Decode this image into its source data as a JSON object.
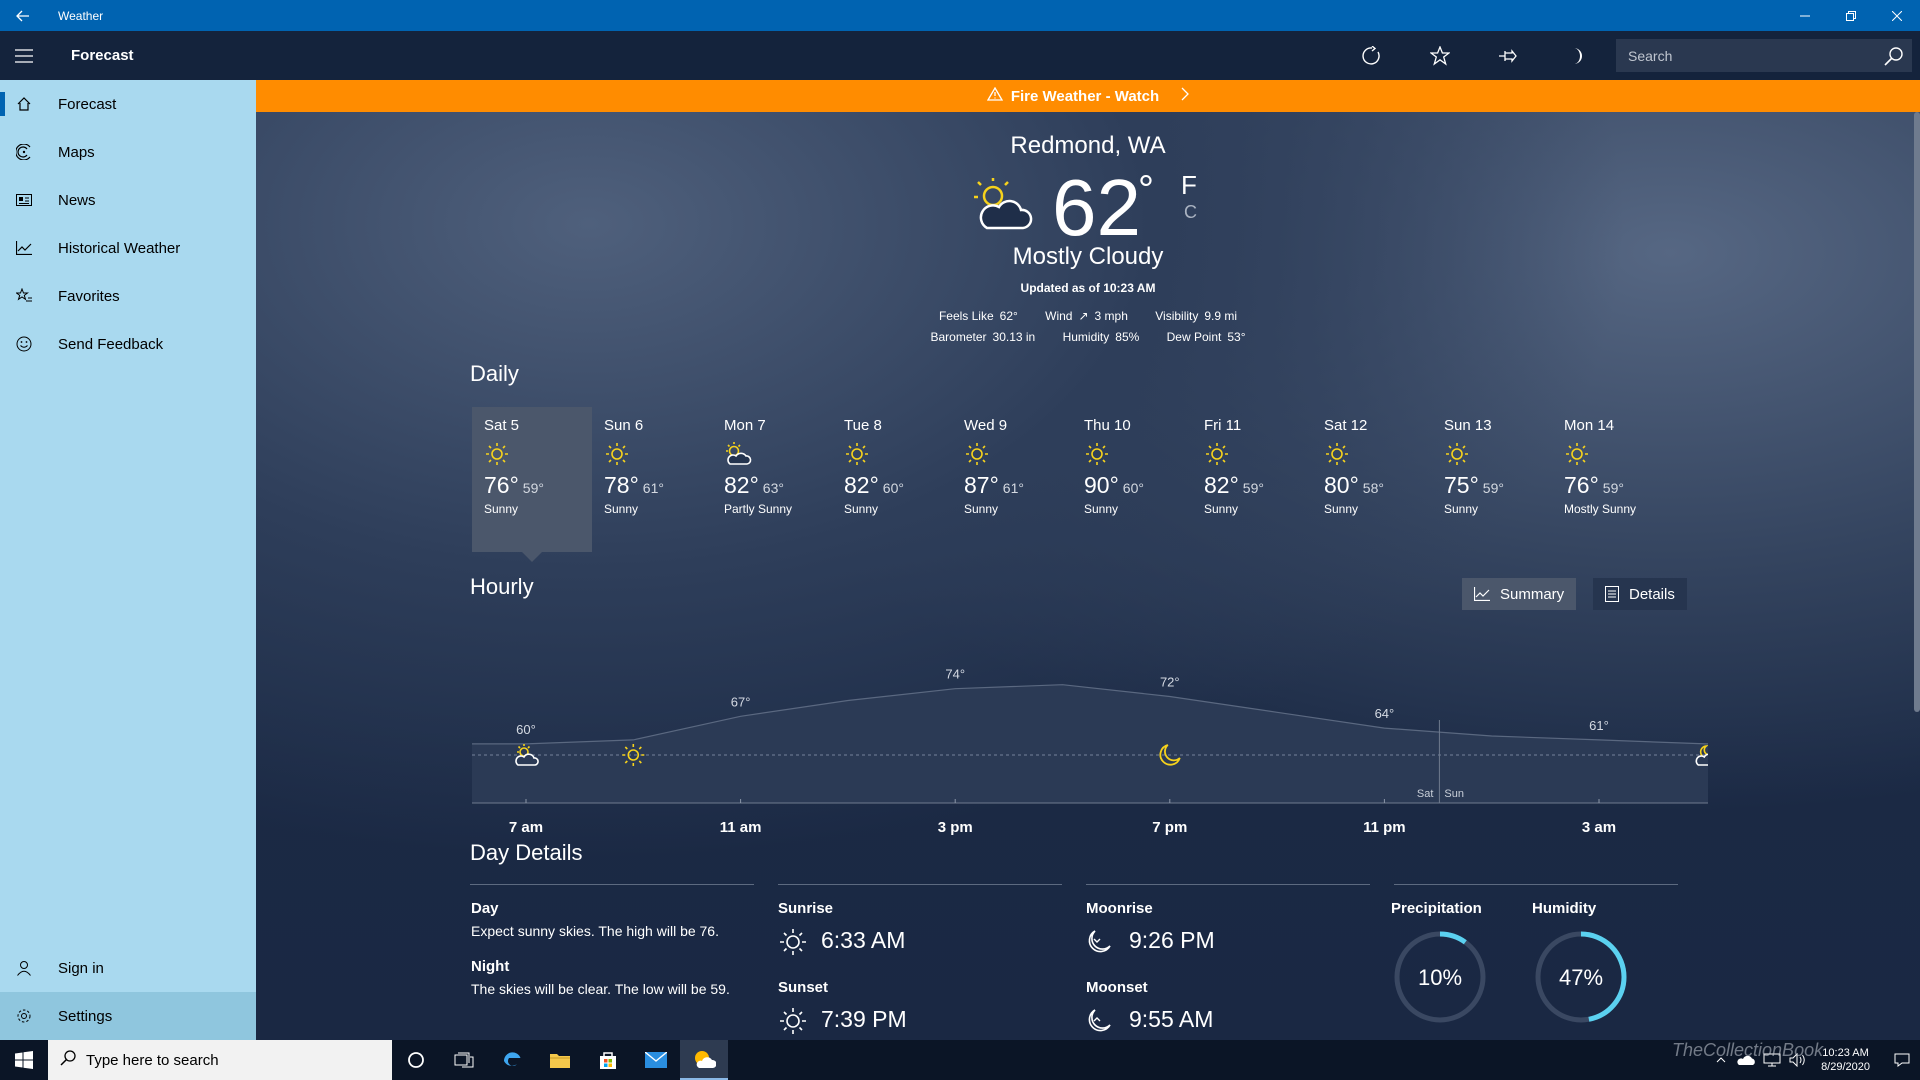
{
  "app": {
    "title": "Weather"
  },
  "header": {
    "page_title": "Forecast",
    "search_placeholder": "Search"
  },
  "sidebar": {
    "items": [
      {
        "label": "Forecast",
        "icon": "home-icon"
      },
      {
        "label": "Maps",
        "icon": "radar-icon"
      },
      {
        "label": "News",
        "icon": "news-icon"
      },
      {
        "label": "Historical Weather",
        "icon": "chart-icon"
      },
      {
        "label": "Favorites",
        "icon": "star-list-icon"
      },
      {
        "label": "Send Feedback",
        "icon": "smiley-icon"
      }
    ],
    "bottom": [
      {
        "label": "Sign in",
        "icon": "person-icon"
      },
      {
        "label": "Settings",
        "icon": "gear-icon"
      }
    ]
  },
  "alert": {
    "text": "Fire Weather - Watch",
    "color": "#ff8c00"
  },
  "current": {
    "location": "Redmond, WA",
    "temp": "62",
    "deg": "°",
    "unit_f": "F",
    "unit_c": "C",
    "condition": "Mostly Cloudy",
    "updated": "Updated as of 10:23 AM",
    "feels_like_label": "Feels Like",
    "feels_like": "62°",
    "wind_label": "Wind",
    "wind": "3 mph",
    "visibility_label": "Visibility",
    "visibility": "9.9 mi",
    "barometer_label": "Barometer",
    "barometer": "30.13 in",
    "humidity_label": "Humidity",
    "humidity": "85%",
    "dewpoint_label": "Dew Point",
    "dewpoint": "53°"
  },
  "daily": {
    "heading": "Daily",
    "days": [
      {
        "name": "Sat 5",
        "hi": "76°",
        "lo": "59°",
        "cond": "Sunny",
        "icon": "sun-icon"
      },
      {
        "name": "Sun 6",
        "hi": "78°",
        "lo": "61°",
        "cond": "Sunny",
        "icon": "sun-icon"
      },
      {
        "name": "Mon 7",
        "hi": "82°",
        "lo": "63°",
        "cond": "Partly Sunny",
        "icon": "partly-sunny-icon"
      },
      {
        "name": "Tue 8",
        "hi": "82°",
        "lo": "60°",
        "cond": "Sunny",
        "icon": "sun-icon"
      },
      {
        "name": "Wed 9",
        "hi": "87°",
        "lo": "61°",
        "cond": "Sunny",
        "icon": "sun-icon"
      },
      {
        "name": "Thu 10",
        "hi": "90°",
        "lo": "60°",
        "cond": "Sunny",
        "icon": "sun-icon"
      },
      {
        "name": "Fri 11",
        "hi": "82°",
        "lo": "59°",
        "cond": "Sunny",
        "icon": "sun-icon"
      },
      {
        "name": "Sat 12",
        "hi": "80°",
        "lo": "58°",
        "cond": "Sunny",
        "icon": "sun-icon"
      },
      {
        "name": "Sun 13",
        "hi": "75°",
        "lo": "59°",
        "cond": "Sunny",
        "icon": "sun-icon"
      },
      {
        "name": "Mon 14",
        "hi": "76°",
        "lo": "59°",
        "cond": "Mostly Sunny",
        "icon": "sun-icon"
      }
    ]
  },
  "hourly": {
    "heading": "Hourly",
    "summary_label": "Summary",
    "details_label": "Details",
    "day_divider": {
      "left": "Sat",
      "right": "Sun"
    }
  },
  "chart_data": {
    "type": "area",
    "x": [
      "7 am",
      "9 am",
      "11 am",
      "1 pm",
      "3 pm",
      "5 pm",
      "7 pm",
      "9 pm",
      "11 pm",
      "1 am",
      "3 am",
      "5 am"
    ],
    "y": [
      60,
      61,
      67,
      71,
      74,
      75,
      72,
      68,
      64,
      62,
      61,
      60
    ],
    "x_tick_labels": [
      "7 am",
      "11 am",
      "3 pm",
      "7 pm",
      "11 pm",
      "3 am"
    ],
    "data_labels": [
      {
        "x": "7 am",
        "label": "60°"
      },
      {
        "x": "11 am",
        "label": "67°"
      },
      {
        "x": "3 pm",
        "label": "74°"
      },
      {
        "x": "7 pm",
        "label": "72°"
      },
      {
        "x": "11 pm",
        "label": "64°"
      },
      {
        "x": "3 am",
        "label": "61°"
      }
    ],
    "condition_icons": [
      {
        "x": "7 am",
        "icon": "partly-sunny-icon"
      },
      {
        "x": "9 am",
        "icon": "sun-icon"
      },
      {
        "x": "7 pm",
        "icon": "moon-icon"
      },
      {
        "x": "5 am",
        "icon": "partly-cloudy-night-icon"
      }
    ],
    "ylim": [
      45,
      80
    ]
  },
  "day_details": {
    "heading": "Day Details",
    "day_label": "Day",
    "day_text": "Expect sunny skies. The high will be 76.",
    "night_label": "Night",
    "night_text": "The skies will be clear. The low will be 59.",
    "sunrise_label": "Sunrise",
    "sunrise": "6:33 AM",
    "sunset_label": "Sunset",
    "sunset": "7:39 PM",
    "moonrise_label": "Moonrise",
    "moonrise": "9:26 PM",
    "moonset_label": "Moonset",
    "moonset": "9:55 AM",
    "precip_label": "Precipitation",
    "precip": "10%",
    "precip_value": 0.1,
    "humidity_label": "Humidity",
    "humidity": "47%",
    "humidity_value": 0.47,
    "accent": "#5bd1f0"
  },
  "taskbar": {
    "search_placeholder": "Type here to search",
    "time": "10:23 AM",
    "date": "8/29/2020",
    "watermark": "TheCollectionBook"
  }
}
